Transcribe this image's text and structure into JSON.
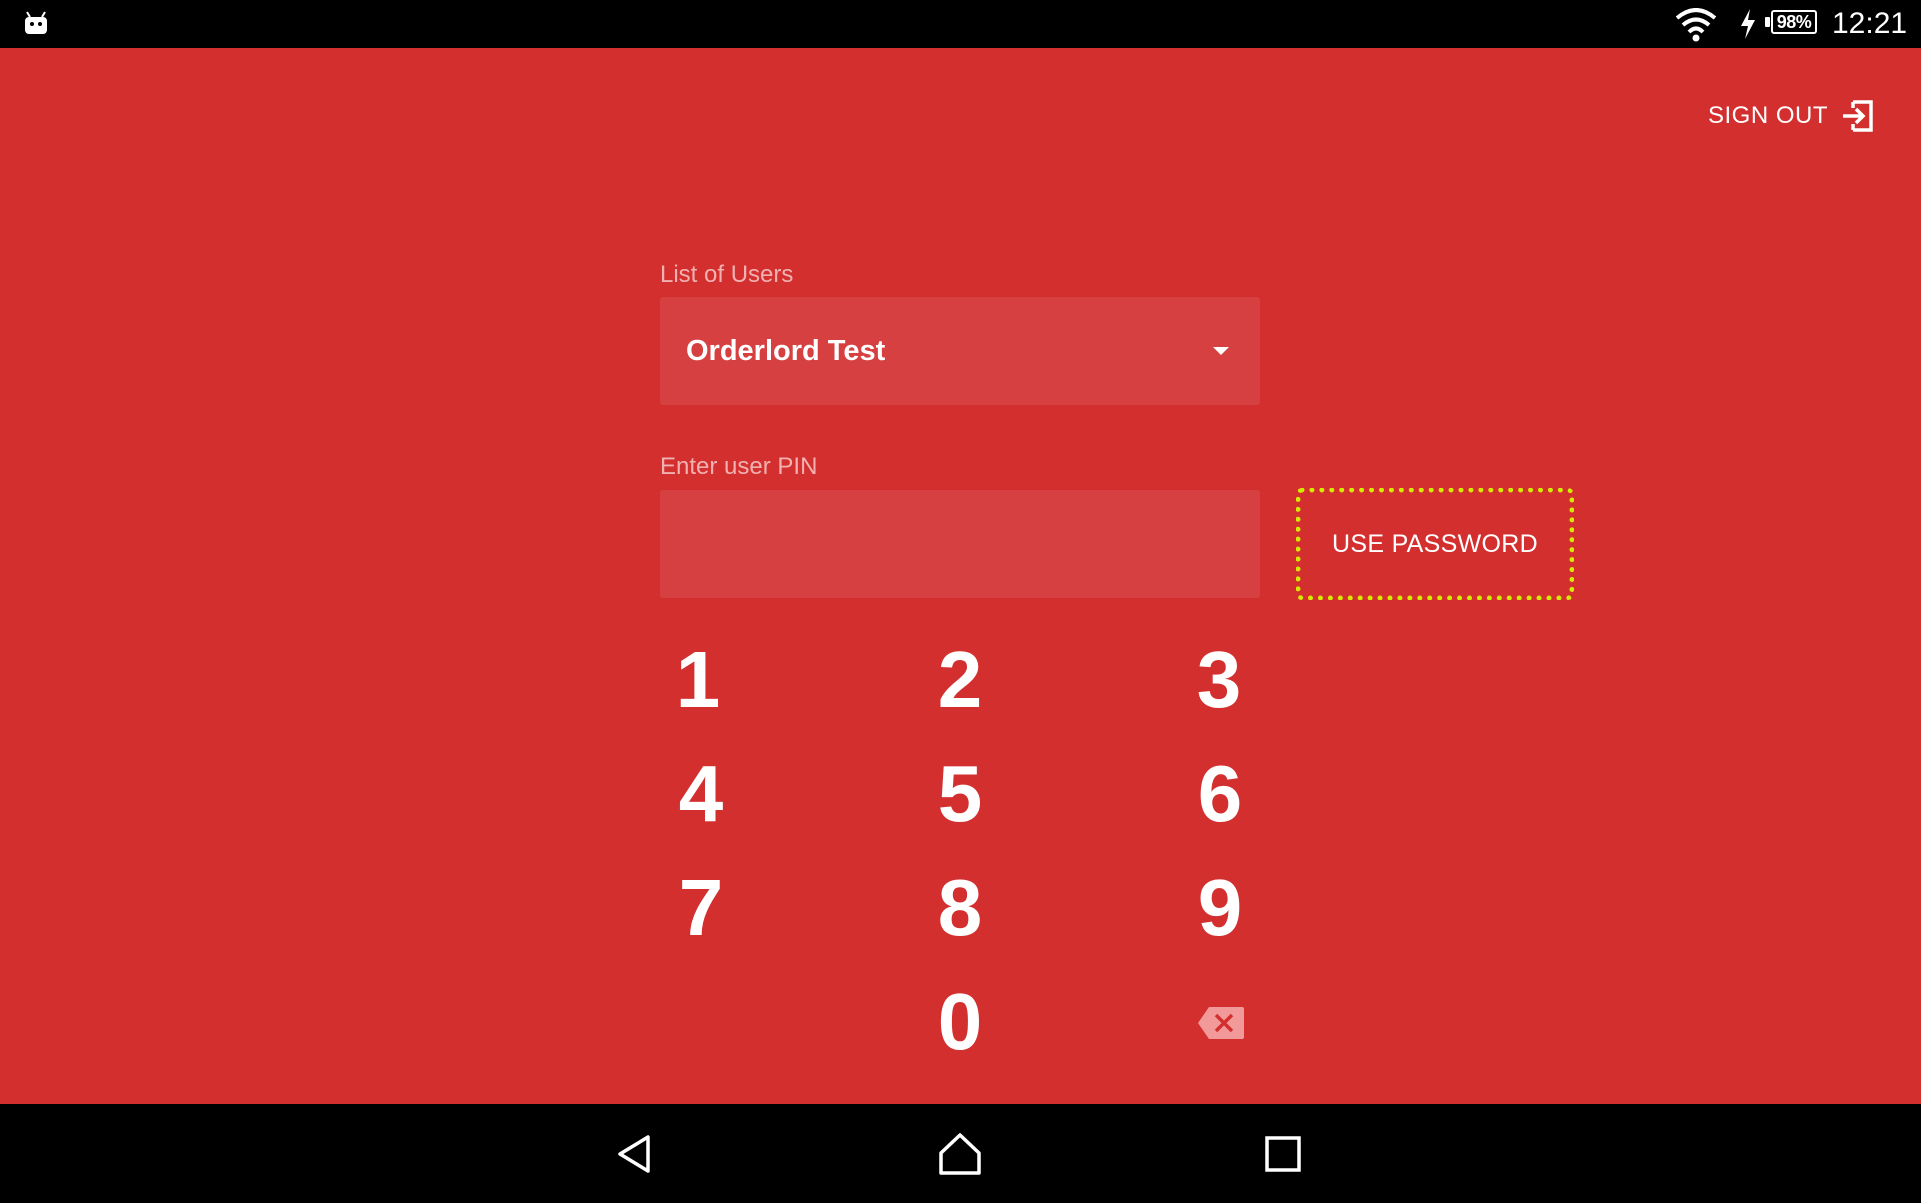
{
  "status_bar": {
    "battery": "98%",
    "time": "12:21",
    "icons": [
      "android-icon",
      "wifi-icon",
      "charging-bolt-icon",
      "battery-icon"
    ]
  },
  "header": {
    "sign_out_label": "SIGN OUT",
    "sign_out_icon": "sign-out-icon"
  },
  "form": {
    "users_label": "List of Users",
    "selected_user": "Orderlord Test",
    "pin_label": "Enter user PIN",
    "pin_value": "",
    "use_password_label": "USE PASSWORD"
  },
  "keypad": {
    "keys": [
      "1",
      "2",
      "3",
      "4",
      "5",
      "6",
      "7",
      "8",
      "9",
      "0"
    ],
    "backspace_icon": "backspace-icon"
  },
  "nav_bar": {
    "icons": [
      "back-icon",
      "home-icon",
      "recents-icon"
    ]
  },
  "colors": {
    "background": "#d32f2f",
    "field": "#d74040",
    "label": "#f2b1b1",
    "highlight": "#d4ea00",
    "bars": "#000000"
  }
}
